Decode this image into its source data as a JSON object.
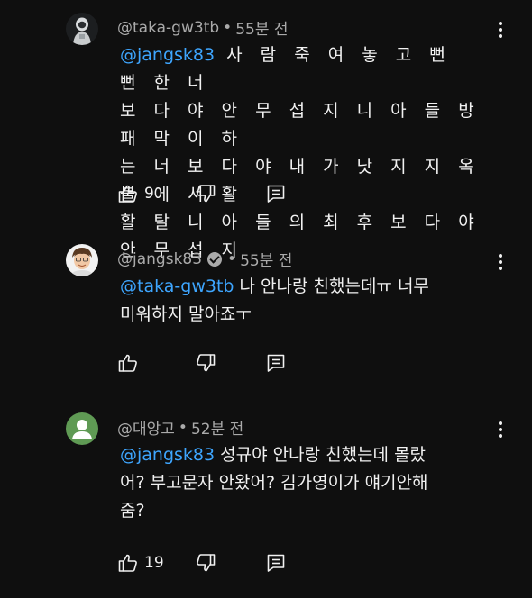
{
  "comments": [
    {
      "handle": "@taka-gw3tb",
      "time": "55분 전",
      "mention": "@jangsk83",
      "lines": [
        "사 람 죽 여 놓 고 뻔 뻔 한 너",
        "보 다 야 안 무 섭 지 니 아 들 방 패 막 이 하",
        "는 너 보 다 야 내 가 낫 지 지 옥 불 에 서 활",
        "활 탈 니 아 들 의 최 후 보 다 야 안 무 섭 지"
      ],
      "likes": "9",
      "verified": false
    },
    {
      "handle": "@jangsk83",
      "time": "55분 전",
      "mention": "@taka-gw3tb",
      "lines": [
        "나 안나랑 친했는데ㅠ 너무",
        "미워하지 말아죠ㅜ"
      ],
      "likes": "",
      "verified": true
    },
    {
      "handle": "@대앙고",
      "time": "52분 전",
      "mention": "@jangsk83",
      "lines": [
        "성규야 안나랑 친했는데 몰랐",
        "어? 부고문자 안왔어? 김가영이가 얘기안해",
        "줌?"
      ],
      "likes": "19",
      "verified": false
    }
  ],
  "separator": " • ",
  "icons": {
    "like": "thumbs-up-icon",
    "dislike": "thumbs-down-icon",
    "reply": "reply-comment-icon",
    "more": "more-vertical-icon"
  },
  "colors": {
    "background": "#0f0f0f",
    "text": "#f1f1f1",
    "meta": "#aaaaaa",
    "mention": "#3ea6ff",
    "avatar_green": "#5f9a54"
  }
}
